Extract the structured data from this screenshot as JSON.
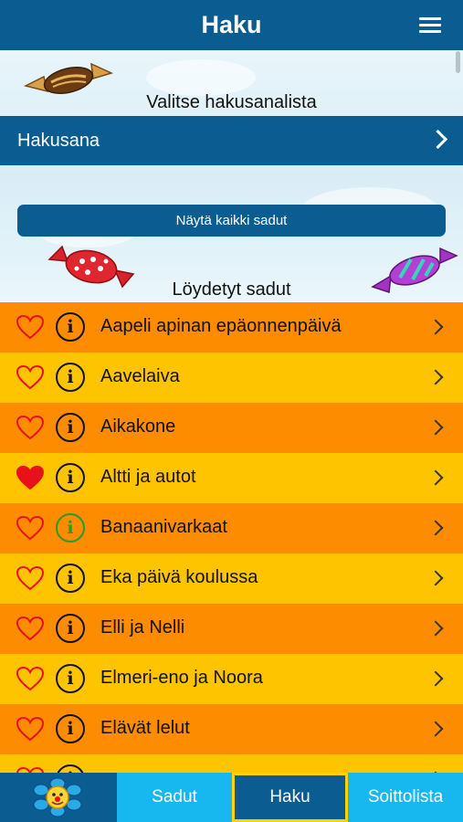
{
  "header": {
    "title": "Haku"
  },
  "search": {
    "prompt": "Valitse hakusanalista",
    "field_label": "Hakusana",
    "show_all_label": "Näytä kaikki sadut"
  },
  "results": {
    "heading": "Löydetyt sadut",
    "items": [
      {
        "title": "Aapeli apinan epäonnenpäivä",
        "favorite": false
      },
      {
        "title": "Aavelaiva",
        "favorite": false
      },
      {
        "title": "Aikakone",
        "favorite": false
      },
      {
        "title": "Altti ja autot",
        "favorite": true
      },
      {
        "title": "Banaanivarkaat",
        "favorite": false
      },
      {
        "title": "Eka päivä koulussa",
        "favorite": false
      },
      {
        "title": "Elli ja Nelli",
        "favorite": false
      },
      {
        "title": "Elmeri-eno ja Noora",
        "favorite": false
      },
      {
        "title": "Elävät lelut",
        "favorite": false
      }
    ]
  },
  "tabbar": {
    "sadut": "Sadut",
    "haku": "Haku",
    "soittolista": "Soittolista"
  },
  "colors": {
    "header": "#0b5d91",
    "orange": "#fe8c00",
    "yellow": "#ffc400",
    "tab": "#17b7f0",
    "active_border": "#ffd200"
  }
}
